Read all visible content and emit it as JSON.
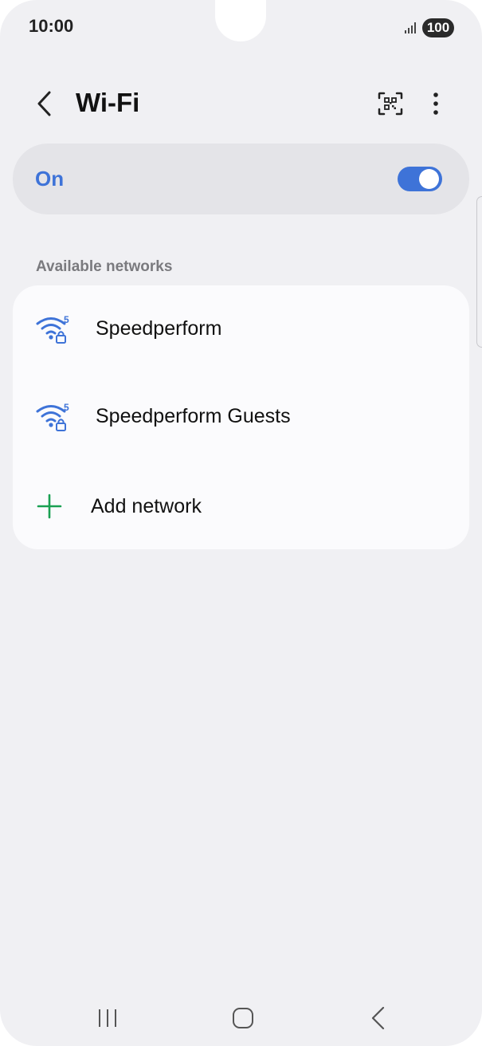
{
  "status_bar": {
    "time": "10:00",
    "battery": "100",
    "signal_icon": "signal-bars-icon"
  },
  "header": {
    "title": "Wi-Fi",
    "back_icon": "chevron-left-icon",
    "qr_icon": "qr-scan-icon",
    "more_icon": "more-vertical-icon"
  },
  "master_switch": {
    "label": "On",
    "enabled": true,
    "accent_color": "#3e73d8"
  },
  "available_networks": {
    "section_label": "Available networks",
    "items": [
      {
        "name": "Speedperform",
        "icon": "wifi-5ghz-locked-icon",
        "band": "5"
      },
      {
        "name": "Speedperform Guests",
        "icon": "wifi-5ghz-locked-icon",
        "band": "5"
      }
    ],
    "add_network_label": "Add network",
    "add_icon_color": "#1aa052"
  },
  "nav_bar": {
    "recents_icon": "recents-icon",
    "home_icon": "home-icon",
    "back_icon": "back-icon"
  }
}
